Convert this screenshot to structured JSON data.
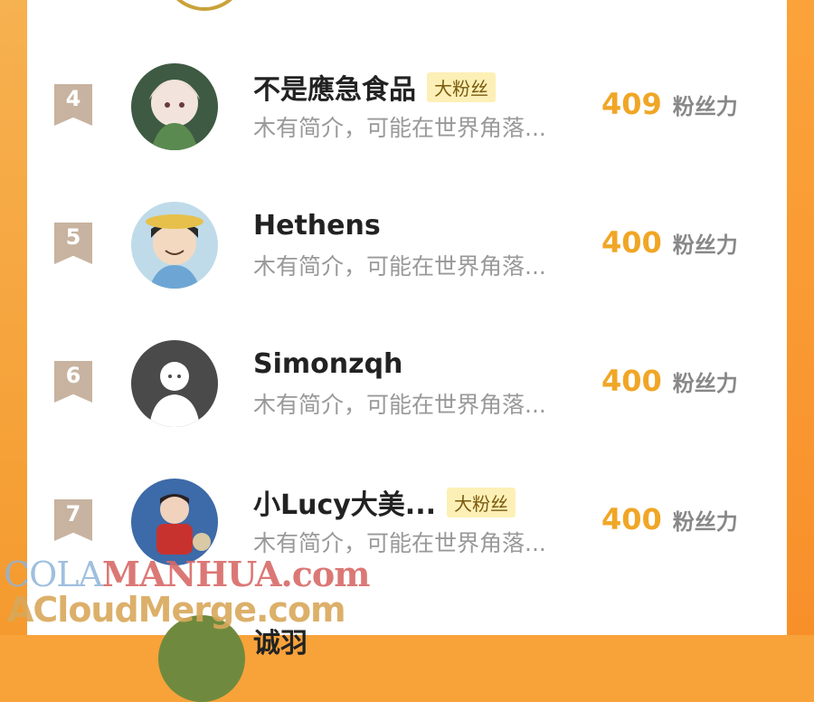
{
  "entries": [
    {
      "rank": "4",
      "name": "不是應急食品",
      "tag": "大粉丝",
      "bio": "木有简介，可能在世界角落...",
      "score": "409",
      "unit": "粉丝力"
    },
    {
      "rank": "5",
      "name": "Hethens",
      "tag": "",
      "bio": "木有简介，可能在世界角落...",
      "score": "400",
      "unit": "粉丝力"
    },
    {
      "rank": "6",
      "name": "Simonzqh",
      "tag": "",
      "bio": "木有简介，可能在世界角落...",
      "score": "400",
      "unit": "粉丝力"
    },
    {
      "rank": "7",
      "name": "小Lucy大美...",
      "tag": "大粉丝",
      "bio": "木有简介，可能在世界角落...",
      "score": "400",
      "unit": "粉丝力"
    }
  ],
  "next_entry_name_partial": "诚羽",
  "watermark": {
    "line1_a": "COLA",
    "line1_b": "MANHUA.com",
    "line2": "ACloudMerge.com"
  },
  "colors": {
    "accent_score": "#f0a626",
    "side_bar": "#f8a23a",
    "tag_bg": "#fdf0b6",
    "rank_badge": "#c7b3a0"
  }
}
